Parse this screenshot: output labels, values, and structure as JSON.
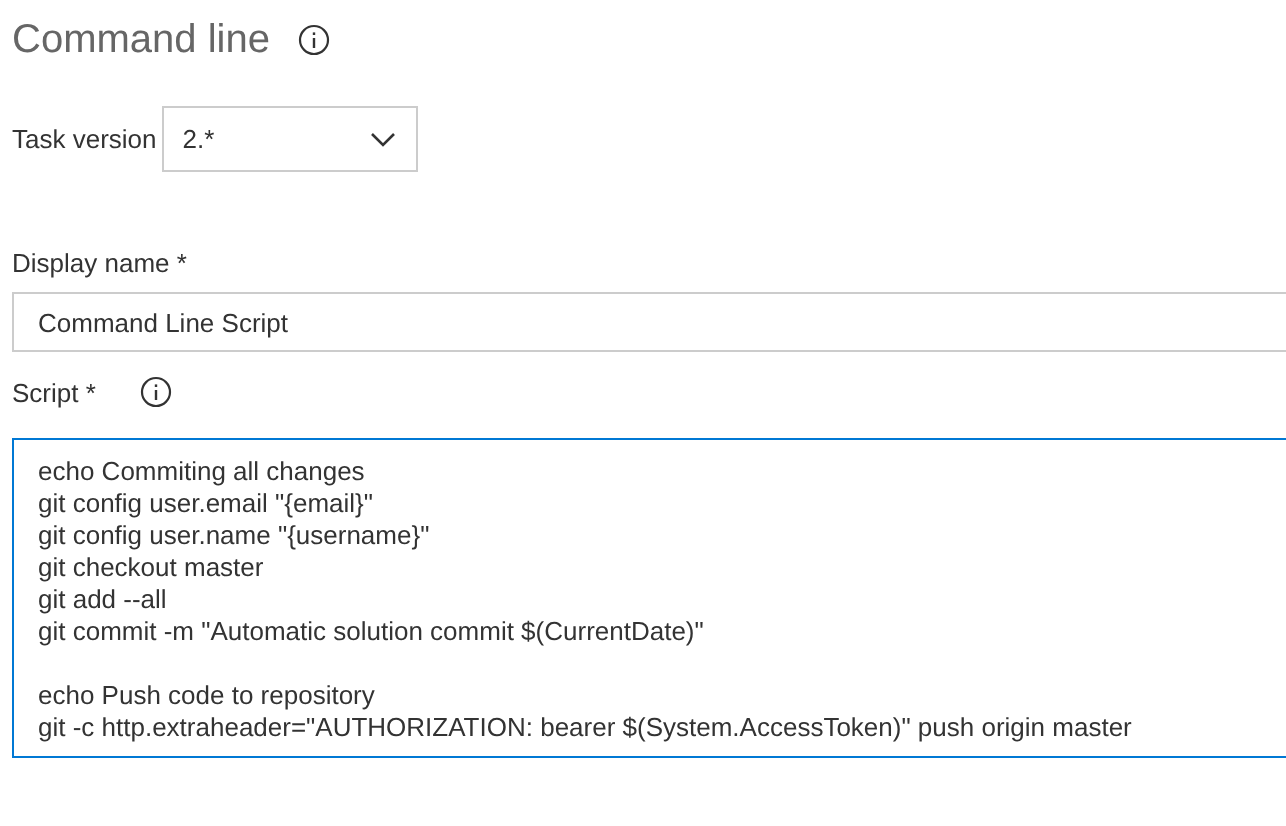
{
  "header": {
    "title": "Command line",
    "info_icon": true
  },
  "task_version": {
    "label": "Task version",
    "value": "2.*"
  },
  "display_name": {
    "label": "Display name *",
    "value": "Command Line Script"
  },
  "script": {
    "label": "Script *",
    "info_icon": true,
    "focused": true,
    "paragraphs": [
      [
        "echo Commiting all changes",
        "git config user.email \"{email}\"",
        "git config user.name \"{username}\"",
        "git checkout master",
        "git add --all",
        "git commit -m \"Automatic solution commit $(CurrentDate)\""
      ],
      [
        "echo Push code to repository",
        "git -c http.extraheader=\"AUTHORIZATION: bearer $(System.AccessToken)\" push origin master"
      ]
    ]
  }
}
